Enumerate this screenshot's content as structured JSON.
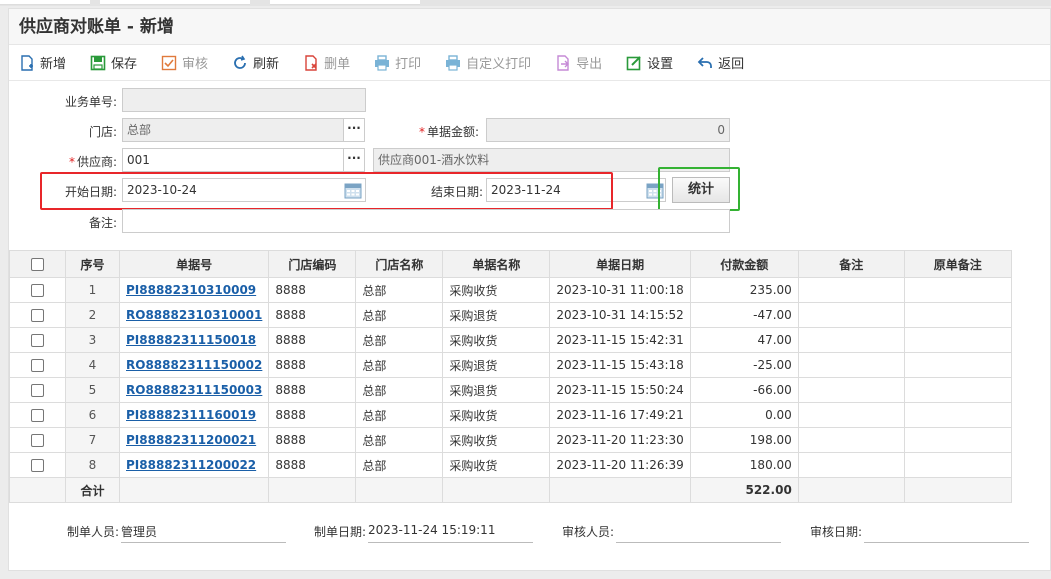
{
  "page": {
    "title": "供应商对账单 - 新增"
  },
  "toolbar": {
    "items": [
      {
        "label": "新增",
        "icon": "add-doc-icon",
        "color": "#2a6fb0",
        "enabled": true
      },
      {
        "label": "保存",
        "icon": "save-icon",
        "color": "#2a9a3a",
        "enabled": true
      },
      {
        "label": "审核",
        "icon": "approve-icon",
        "color": "#e07a3c",
        "enabled": false
      },
      {
        "label": "刷新",
        "icon": "refresh-icon",
        "color": "#2a6fb0",
        "enabled": true
      },
      {
        "label": "删单",
        "icon": "delete-doc-icon",
        "color": "#d9443a",
        "enabled": false
      },
      {
        "label": "打印",
        "icon": "print-icon",
        "color": "#7ab3d6",
        "enabled": false
      },
      {
        "label": "自定义打印",
        "icon": "custom-print-icon",
        "color": "#7ab3d6",
        "enabled": false
      },
      {
        "label": "导出",
        "icon": "export-icon",
        "color": "#c58ad6",
        "enabled": false
      },
      {
        "label": "设置",
        "icon": "settings-icon",
        "color": "#2a9a3a",
        "enabled": true
      },
      {
        "label": "返回",
        "icon": "back-icon",
        "color": "#2a6fb0",
        "enabled": true
      }
    ]
  },
  "form": {
    "doc_no_label": "业务单号:",
    "doc_no_value": "",
    "store_label": "门店:",
    "store_value": "总部",
    "amount_label": "单据金额:",
    "amount_value": "0",
    "supplier_label": "供应商:",
    "supplier_code": "001",
    "supplier_name": "供应商001-酒水饮料",
    "start_date_label": "开始日期:",
    "start_date": "2023-10-24",
    "end_date_label": "结束日期:",
    "end_date": "2023-11-24",
    "stat_button": "统计",
    "remark_label": "备注:",
    "remark_value": "",
    "required_mark": "*"
  },
  "table": {
    "headers": [
      "序号",
      "单据号",
      "门店编码",
      "门店名称",
      "单据名称",
      "单据日期",
      "付款金额",
      "备注",
      "原单备注"
    ],
    "rows": [
      {
        "seq": "1",
        "doc": "PI88882310310009",
        "store_code": "8888",
        "store_name": "总部",
        "doc_name": "采购收货",
        "date": "2023-10-31 11:00:18",
        "amount": "235.00"
      },
      {
        "seq": "2",
        "doc": "RO88882310310001",
        "store_code": "8888",
        "store_name": "总部",
        "doc_name": "采购退货",
        "date": "2023-10-31 14:15:52",
        "amount": "-47.00"
      },
      {
        "seq": "3",
        "doc": "PI8888231115001 8",
        "store_code": "8888",
        "store_name": "总部",
        "doc_name": "采购收货",
        "date": "2023-11-15 15:42:31",
        "amount": "47.00"
      },
      {
        "seq": "4",
        "doc": "RO88882311150002",
        "store_code": "8888",
        "store_name": "总部",
        "doc_name": "采购退货",
        "date": "2023-11-15 15:43:18",
        "amount": "-25.00"
      },
      {
        "seq": "5",
        "doc": "RO88882311150003",
        "store_code": "8888",
        "store_name": "总部",
        "doc_name": "采购退货",
        "date": "2023-11-15 15:50:24",
        "amount": "-66.00"
      },
      {
        "seq": "6",
        "doc": "PI88882311160019",
        "store_code": "8888",
        "store_name": "总部",
        "doc_name": "采购收货",
        "date": "2023-11-16 17:49:21",
        "amount": "0.00"
      },
      {
        "seq": "7",
        "doc": "PI88882311200021",
        "store_code": "8888",
        "store_name": "总部",
        "doc_name": "采购收货",
        "date": "2023-11-20 11:23:30",
        "amount": "198.00"
      },
      {
        "seq": "8",
        "doc": "PI88882311200022",
        "store_code": "8888",
        "store_name": "总部",
        "doc_name": "采购收货",
        "date": "2023-11-20 11:26:39",
        "amount": "180.00"
      }
    ],
    "total_label": "合计",
    "total_amount": "522.00"
  },
  "footer": {
    "creator_label": "制单人员:",
    "creator_value": "管理员",
    "create_date_label": "制单日期:",
    "create_date_value": "2023-11-24 15:19:11",
    "auditor_label": "审核人员:",
    "auditor_value": "",
    "audit_date_label": "审核日期:",
    "audit_date_value": ""
  },
  "colors": {
    "highlight_red": "#e8262a",
    "highlight_green": "#34b233",
    "link": "#1a5fa8"
  }
}
